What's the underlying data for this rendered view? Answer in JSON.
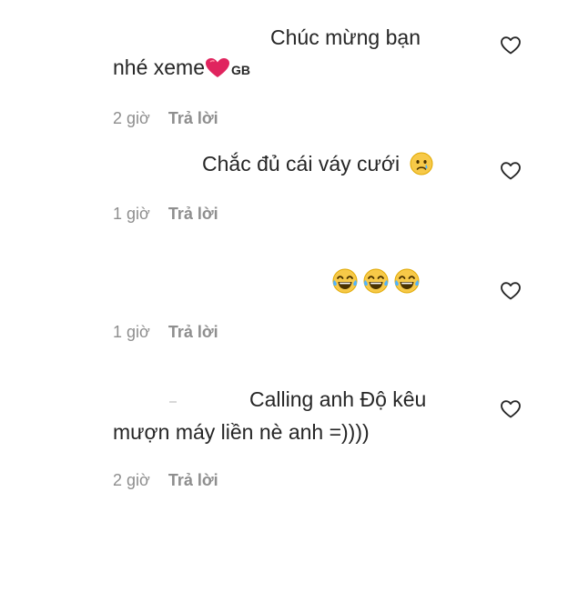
{
  "comments": [
    {
      "lines": [
        "Chúc mừng bạn",
        "nhé xeme"
      ],
      "badge": "GB",
      "emoji": "heart-emoji",
      "time": "2 giờ",
      "reply": "Trả lời"
    },
    {
      "lines": [
        "Chắc đủ cái váy cưới"
      ],
      "emoji": "crying-face-emoji",
      "time": "1 giờ",
      "reply": "Trả lời"
    },
    {
      "lines": [],
      "emoji": "tears-of-joy-emoji",
      "emoji_count": 3,
      "time": "1 giờ",
      "reply": "Trả lời"
    },
    {
      "lines": [
        "Calling anh Độ kêu",
        "mượn máy liền nè anh =))))"
      ],
      "time": "2 giờ",
      "reply": "Trả lời"
    }
  ],
  "colors": {
    "text": "#262626",
    "meta": "#8e8e8e",
    "heart": "#e0245e",
    "emoji_face": "#f7c948"
  },
  "icons": {
    "like": "heart-outline-icon"
  }
}
